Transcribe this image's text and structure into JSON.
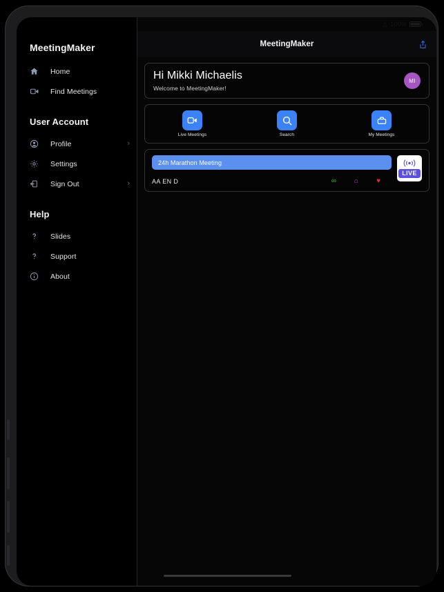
{
  "statusbar": {
    "wifi_icon": "wifi-icon",
    "battery_level": "100%",
    "battery_icon": "battery-full-icon"
  },
  "sidebar": {
    "brand": "MeetingMaker",
    "nav": [
      {
        "label": "Home",
        "icon": "home-icon",
        "chevron": ""
      },
      {
        "label": "Find Meetings",
        "icon": "video-camera-icon",
        "chevron": ""
      }
    ],
    "account_section_title": "User Account",
    "account_items": [
      {
        "label": "Profile",
        "icon": "user-circle-icon",
        "chevron": "›"
      },
      {
        "label": "Settings",
        "icon": "gear-icon",
        "chevron": ""
      },
      {
        "label": "Sign Out",
        "icon": "sign-out-icon",
        "chevron": "›"
      }
    ],
    "help_section_title": "Help",
    "help_items": [
      {
        "label": "Slides",
        "icon": "question-mark-icon",
        "chevron": ""
      },
      {
        "label": "Support",
        "icon": "question-mark-icon",
        "chevron": ""
      },
      {
        "label": "About",
        "icon": "info-circle-icon",
        "chevron": ""
      }
    ]
  },
  "header": {
    "title": "MeetingMaker",
    "share_icon": "share-icon"
  },
  "greeting": {
    "title": "Hi Mikki Michaelis",
    "subtitle": "Welcome to MeetingMaker!",
    "avatar_initials": "MI",
    "avatar_color": "#a855c4"
  },
  "actions": [
    {
      "label": "Live Meetings",
      "icon": "video-camera-icon"
    },
    {
      "label": "Search",
      "icon": "search-icon"
    },
    {
      "label": "My Meetings",
      "icon": "briefcase-icon"
    }
  ],
  "meeting": {
    "title": "24h Marathon Meeting",
    "meta": "AA EN D",
    "icons": [
      {
        "name": "infinity-icon",
        "glyph": "∞",
        "color": "#35c43a"
      },
      {
        "name": "house-icon",
        "glyph": "⌂",
        "color": "#b43fd4"
      },
      {
        "name": "heart-icon",
        "glyph": "♥",
        "color": "#e02b32"
      }
    ],
    "live_label": "LIVE",
    "live_icon": "broadcast-icon",
    "accent_color": "#5b90ef",
    "live_color": "#5a4fe0"
  }
}
